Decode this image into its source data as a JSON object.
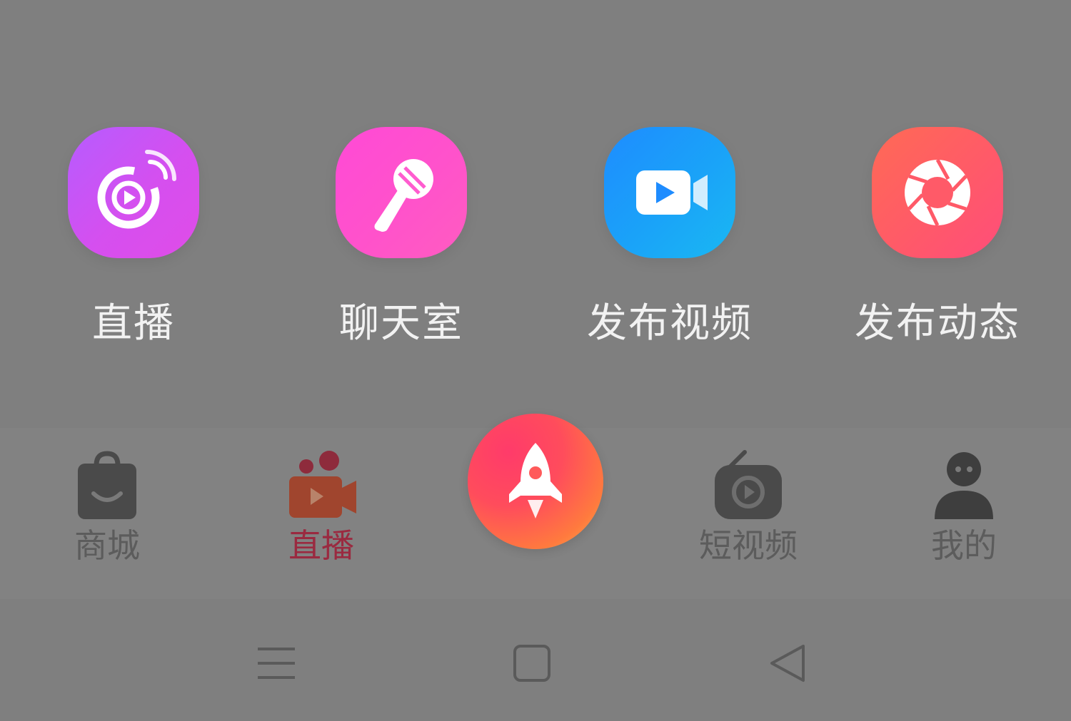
{
  "publish_menu": {
    "actions": [
      {
        "label": "直播",
        "icon": "live-broadcast-icon",
        "colors": [
          "#b65cff",
          "#e04ce8"
        ]
      },
      {
        "label": "聊天室",
        "icon": "microphone-icon",
        "colors": [
          "#ff4ad6",
          "#ff5cc0"
        ]
      },
      {
        "label": "发布视频",
        "icon": "video-camera-icon",
        "colors": [
          "#1e8cff",
          "#19b8f2"
        ]
      },
      {
        "label": "发布动态",
        "icon": "camera-aperture-icon",
        "colors": [
          "#ff6a55",
          "#ff4d7a"
        ]
      }
    ]
  },
  "tab_bar": {
    "tabs": [
      {
        "label": "商城",
        "icon": "shopping-bag-icon",
        "active": false
      },
      {
        "label": "直播",
        "icon": "live-camera-icon",
        "active": true
      },
      {
        "label": "短视频",
        "icon": "short-video-icon",
        "active": false
      },
      {
        "label": "我的",
        "icon": "profile-icon",
        "active": false
      }
    ],
    "center_button": {
      "icon": "rocket-icon"
    },
    "inactive_color": "#5c5c5c",
    "active_color": "#9a2a40"
  },
  "system_nav": {
    "buttons": [
      {
        "icon": "menu-icon"
      },
      {
        "icon": "home-square-icon"
      },
      {
        "icon": "back-triangle-icon"
      }
    ]
  },
  "overlay_color": "#7f7f7f"
}
